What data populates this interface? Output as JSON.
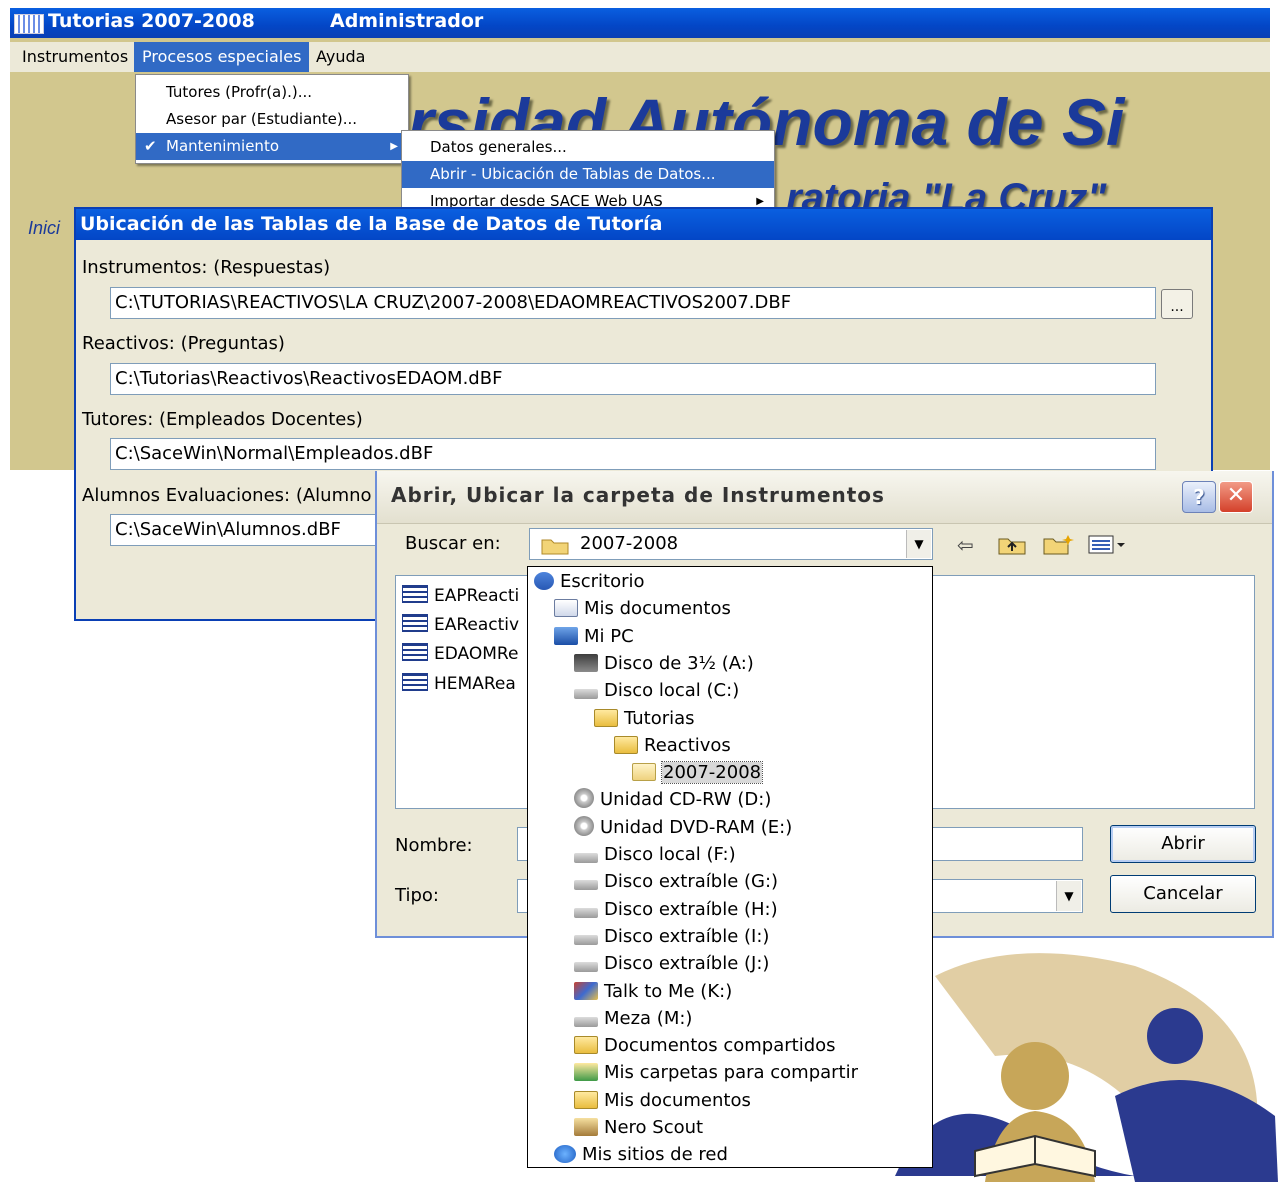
{
  "app": {
    "title_product": "Tutorias  2007-2008",
    "title_user": "Administrador",
    "menus": [
      "Instrumentos",
      "Procesos especiales",
      "Ayuda"
    ],
    "background_title": "rsidad Autónoma de Si",
    "background_subtitle": "ratoria \"La Cruz\"",
    "background_left": "Inici"
  },
  "procesos_menu": {
    "items": [
      {
        "label": "Tutores (Profr(a).)..."
      },
      {
        "label": "Asesor par (Estudiante)..."
      },
      {
        "label": "Mantenimiento",
        "check": "✔",
        "arrow": "▶"
      }
    ]
  },
  "mantenimiento_menu": {
    "items": [
      {
        "label": "Datos generales..."
      },
      {
        "label": "Abrir  -  Ubicación de Tablas de Datos..."
      },
      {
        "label": "Importar desde SACE Web  UAS",
        "arrow": "▶"
      }
    ]
  },
  "tables_dialog": {
    "title": "Ubicación de las Tablas de la Base de Datos de Tutoría",
    "fields": [
      {
        "label": "Instrumentos:   (Respuestas)",
        "value": "C:\\TUTORIAS\\REACTIVOS\\LA CRUZ\\2007-2008\\EDAOMREACTIVOS2007.DBF"
      },
      {
        "label": "Reactivos:  (Preguntas)",
        "value": "C:\\Tutorias\\Reactivos\\ReactivosEDAOM.dBF"
      },
      {
        "label": "Tutores:  (Empleados Docentes)",
        "value": "C:\\SaceWin\\Normal\\Empleados.dBF"
      },
      {
        "label": "Alumnos Evaluaciones:  (Alumno",
        "value": "C:\\SaceWin\\Alumnos.dBF"
      }
    ],
    "browse_label": "..."
  },
  "open_dialog": {
    "title": "Abrir,  Ubicar la carpeta de  Instrumentos",
    "help_label": "?",
    "close_label": "✕",
    "look_in_label": "Buscar en:",
    "look_in_value": "2007-2008",
    "files": [
      "EAPReacti",
      "EAReactiv",
      "EDAOMRe",
      "HEMARea"
    ],
    "name_label": "Nombre:",
    "name_value": "",
    "type_label": "Tipo:",
    "type_value": "",
    "open_button": "Abrir",
    "cancel_button": "Cancelar",
    "toolbar_icons": [
      "back-arrow-icon",
      "up-folder-icon",
      "new-folder-icon",
      "view-menu-icon"
    ]
  },
  "tree": [
    {
      "label": "Escritorio",
      "icon": "desktop-icon",
      "level": 0
    },
    {
      "label": "Mis documentos",
      "icon": "documents-icon",
      "level": 1
    },
    {
      "label": "Mi PC",
      "icon": "computer-icon",
      "level": 1
    },
    {
      "label": "Disco de 3½ (A:)",
      "icon": "floppy-icon",
      "level": 2
    },
    {
      "label": "Disco local (C:)",
      "icon": "drive-icon",
      "level": 2
    },
    {
      "label": "Tutorias",
      "icon": "folder-icon",
      "level": 3
    },
    {
      "label": "Reactivos",
      "icon": "folder-icon",
      "level": 4
    },
    {
      "label": "2007-2008",
      "icon": "folder-open-icon",
      "level": 5,
      "selected": true
    },
    {
      "label": "Unidad CD-RW (D:)",
      "icon": "cd-icon",
      "level": 2
    },
    {
      "label": "Unidad DVD-RAM (E:)",
      "icon": "cd-icon",
      "level": 2
    },
    {
      "label": "Disco local (F:)",
      "icon": "drive-icon",
      "level": 2
    },
    {
      "label": "Disco extraíble (G:)",
      "icon": "drive-icon",
      "level": 2
    },
    {
      "label": "Disco extraíble (H:)",
      "icon": "drive-icon",
      "level": 2
    },
    {
      "label": "Disco extraíble (I:)",
      "icon": "drive-icon",
      "level": 2
    },
    {
      "label": "Disco extraíble (J:)",
      "icon": "drive-icon",
      "level": 2
    },
    {
      "label": "Talk to Me (K:)",
      "icon": "talk-icon",
      "level": 2
    },
    {
      "label": "Meza (M:)",
      "icon": "drive-icon",
      "level": 2
    },
    {
      "label": "Documentos compartidos",
      "icon": "folder-icon",
      "level": 2
    },
    {
      "label": "Mis carpetas para compartir",
      "icon": "share-icon",
      "level": 2
    },
    {
      "label": "Mis documentos",
      "icon": "folder-icon",
      "level": 2
    },
    {
      "label": "Nero Scout",
      "icon": "nero-icon",
      "level": 2
    },
    {
      "label": "Mis sitios de red",
      "icon": "network-icon",
      "level": 1
    }
  ],
  "colors": {
    "titlebar_blue": "#0346c6",
    "menu_highlight": "#316ac5",
    "app_background": "#d2c78e",
    "background_text": "#1b3a9a"
  }
}
